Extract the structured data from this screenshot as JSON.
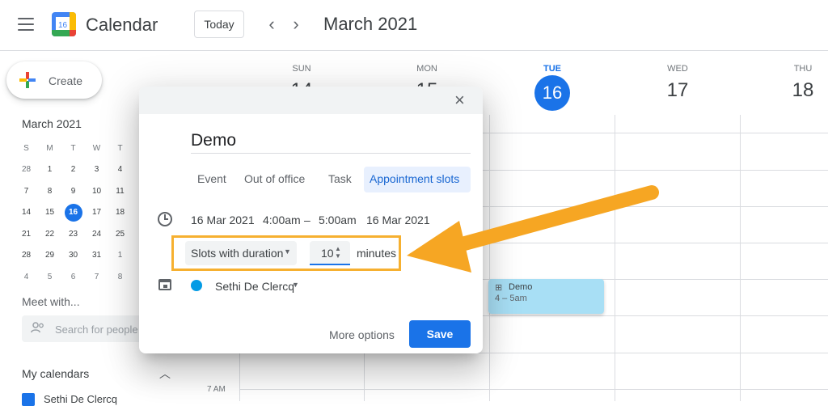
{
  "header": {
    "app_title": "Calendar",
    "logo_number": "16",
    "today_label": "Today",
    "prev_label": "‹",
    "next_label": "›",
    "month_title": "March 2021"
  },
  "sidebar": {
    "create_label": "Create",
    "mini_calendar": {
      "title": "March 2021",
      "weekdays": [
        "S",
        "M",
        "T",
        "W",
        "T"
      ],
      "weeks": [
        [
          "28",
          "1",
          "2",
          "3",
          "4"
        ],
        [
          "7",
          "8",
          "9",
          "10",
          "11"
        ],
        [
          "14",
          "15",
          "16",
          "17",
          "18"
        ],
        [
          "21",
          "22",
          "23",
          "24",
          "25"
        ],
        [
          "28",
          "29",
          "30",
          "31",
          "1"
        ],
        [
          "4",
          "5",
          "6",
          "7",
          "8"
        ]
      ],
      "selected": "16"
    },
    "meet_title": "Meet with...",
    "people_placeholder": "Search for people",
    "my_calendars_title": "My calendars",
    "calendar_item": "Sethi De Clercq"
  },
  "grid": {
    "days": [
      {
        "name": "SUN",
        "num": "14"
      },
      {
        "name": "MON",
        "num": "15"
      },
      {
        "name": "TUE",
        "num": "16"
      },
      {
        "name": "WED",
        "num": "17"
      },
      {
        "name": "THU",
        "num": "18"
      }
    ],
    "time_label_7am": "7 AM",
    "event": {
      "title": "Demo",
      "time": "4 – 5am"
    }
  },
  "dialog": {
    "close_label": "×",
    "title_value": "Demo",
    "tabs": [
      "Event",
      "Out of office",
      "Task",
      "Appointment slots"
    ],
    "active_tab": "Appointment slots",
    "start_date": "16 Mar 2021",
    "start_time": "4:00am",
    "separator": "–",
    "end_time": "5:00am",
    "end_date": "16 Mar 2021",
    "slots_select": "Slots with duration",
    "duration_value": "10",
    "duration_unit": "minutes",
    "calendar_owner": "Sethi De Clercq",
    "more_options_label": "More options",
    "save_label": "Save"
  },
  "colors": {
    "accent": "#1a73e8",
    "highlight_box": "#f6b030",
    "event_bg": "#a8dff5"
  }
}
